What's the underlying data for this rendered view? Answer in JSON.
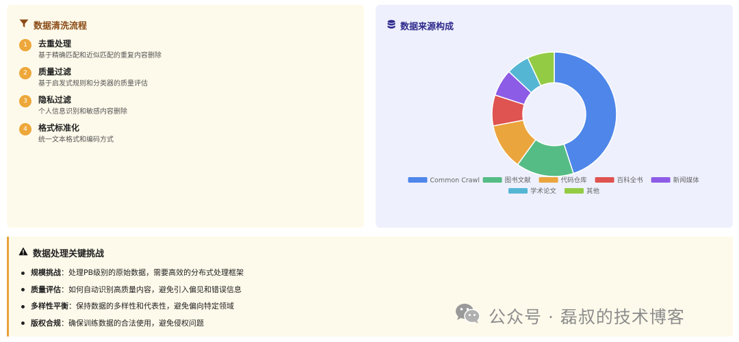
{
  "pipeline": {
    "title": "数据清洗流程",
    "steps": [
      {
        "num": "1",
        "title": "去重处理",
        "desc": "基于精确匹配和近似匹配的重复内容删除"
      },
      {
        "num": "2",
        "title": "质量过滤",
        "desc": "基于启发式规则和分类器的质量评估"
      },
      {
        "num": "3",
        "title": "隐私过滤",
        "desc": "个人信息识别和敏感内容删除"
      },
      {
        "num": "4",
        "title": "格式标准化",
        "desc": "统一文本格式和编码方式"
      }
    ]
  },
  "sources": {
    "title": "数据来源构成"
  },
  "chart_data": {
    "type": "pie",
    "donut": true,
    "legend_position": "bottom",
    "slices": [
      {
        "name": "Common Crawl",
        "value": 45,
        "color": "#4e86ea"
      },
      {
        "name": "图书文献",
        "value": 15,
        "color": "#55bc85"
      },
      {
        "name": "代码仓库",
        "value": 12,
        "color": "#eba53d"
      },
      {
        "name": "百科全书",
        "value": 8,
        "color": "#df5350"
      },
      {
        "name": "新闻媒体",
        "value": 7,
        "color": "#8d5ce6"
      },
      {
        "name": "学术论文",
        "value": 6,
        "color": "#55b6d4"
      },
      {
        "name": "其他",
        "value": 7,
        "color": "#93cc44"
      }
    ]
  },
  "challenges": {
    "title": "数据处理关键挑战",
    "items": [
      {
        "label": "规模挑战",
        "text": "：处理PB级别的原始数据，需要高效的分布式处理框架"
      },
      {
        "label": "质量评估",
        "text": "：如何自动识别高质量内容，避免引入偏见和错误信息"
      },
      {
        "label": "多样性平衡",
        "text": "：保持数据的多样性和代表性，避免偏向特定领域"
      },
      {
        "label": "版权合规",
        "text": "：确保训练数据的合法使用，避免侵权问题"
      }
    ]
  },
  "watermark": {
    "text": "公众号 · 磊叔的技术博客"
  }
}
